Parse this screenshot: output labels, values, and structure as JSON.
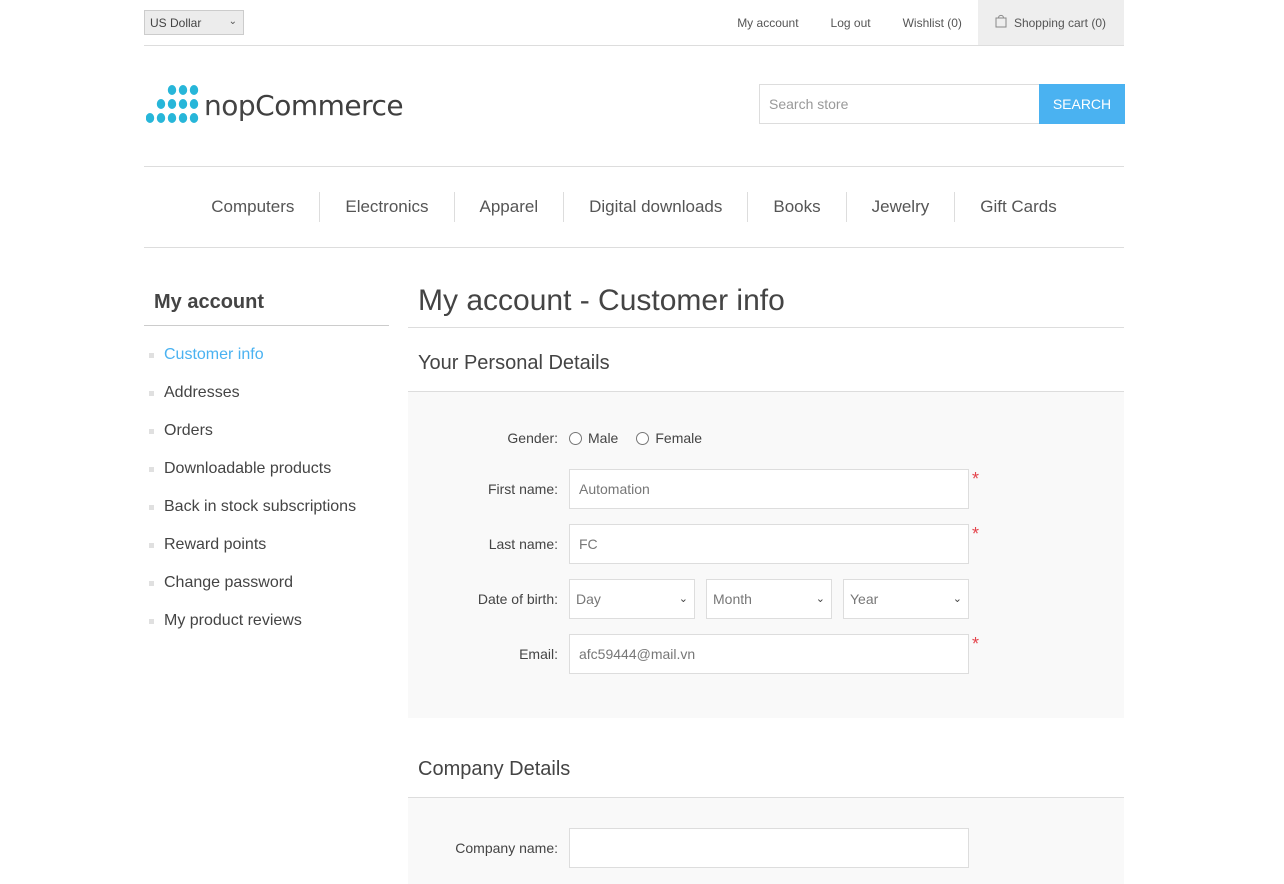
{
  "header": {
    "currency": "US Dollar",
    "links": {
      "my_account": "My account",
      "log_out": "Log out",
      "wishlist": "Wishlist (0)",
      "shopping_cart": "Shopping cart (0)"
    }
  },
  "logo": {
    "text_light": "nop",
    "text_bold": "Commerce",
    "dot_color": "#27b6d9"
  },
  "search": {
    "placeholder": "Search store",
    "button_label": "SEARCH"
  },
  "top_menu": {
    "items": [
      {
        "label": "Computers"
      },
      {
        "label": "Electronics"
      },
      {
        "label": "Apparel"
      },
      {
        "label": "Digital downloads"
      },
      {
        "label": "Books"
      },
      {
        "label": "Jewelry"
      },
      {
        "label": "Gift Cards"
      }
    ]
  },
  "sidebar": {
    "title": "My account",
    "items": [
      {
        "label": "Customer info",
        "active": true
      },
      {
        "label": "Addresses"
      },
      {
        "label": "Orders"
      },
      {
        "label": "Downloadable products"
      },
      {
        "label": "Back in stock subscriptions"
      },
      {
        "label": "Reward points"
      },
      {
        "label": "Change password"
      },
      {
        "label": "My product reviews"
      }
    ]
  },
  "main": {
    "page_title": "My account - Customer info",
    "personal": {
      "title": "Your Personal Details",
      "gender_label": "Gender:",
      "gender_male": "Male",
      "gender_female": "Female",
      "first_name_label": "First name:",
      "first_name_value": "Automation",
      "last_name_label": "Last name:",
      "last_name_value": "FC",
      "dob_label": "Date of birth:",
      "dob_day": "Day",
      "dob_month": "Month",
      "dob_year": "Year",
      "email_label": "Email:",
      "email_value": "afc59444@mail.vn",
      "required_mark": "*"
    },
    "company": {
      "title": "Company Details",
      "company_name_label": "Company name:",
      "company_name_value": ""
    }
  },
  "colors": {
    "accent": "#4ab2f1",
    "required": "#e4444c",
    "panel_bg": "#f9f9f9"
  }
}
